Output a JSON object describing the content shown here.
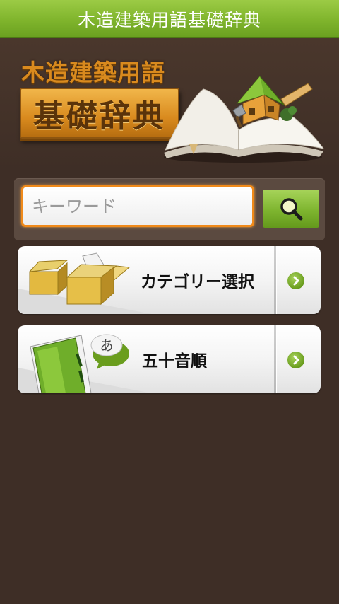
{
  "title_bar": {
    "title": "木造建築用語基礎辞典"
  },
  "logo": {
    "line1": "木造建築用語",
    "line2": "基礎辞典"
  },
  "search": {
    "placeholder": "キーワード",
    "value": ""
  },
  "menu": [
    {
      "label": "カテゴリー選択",
      "icon": "boxes-icon"
    },
    {
      "label": "五十音順",
      "icon": "kana-notebook-icon",
      "bubble": "あ"
    }
  ],
  "colors": {
    "title_bar": "#7fb42c",
    "background": "#3e2e26",
    "search_border": "#f08a1a",
    "arrow": "#6a9d1e"
  }
}
